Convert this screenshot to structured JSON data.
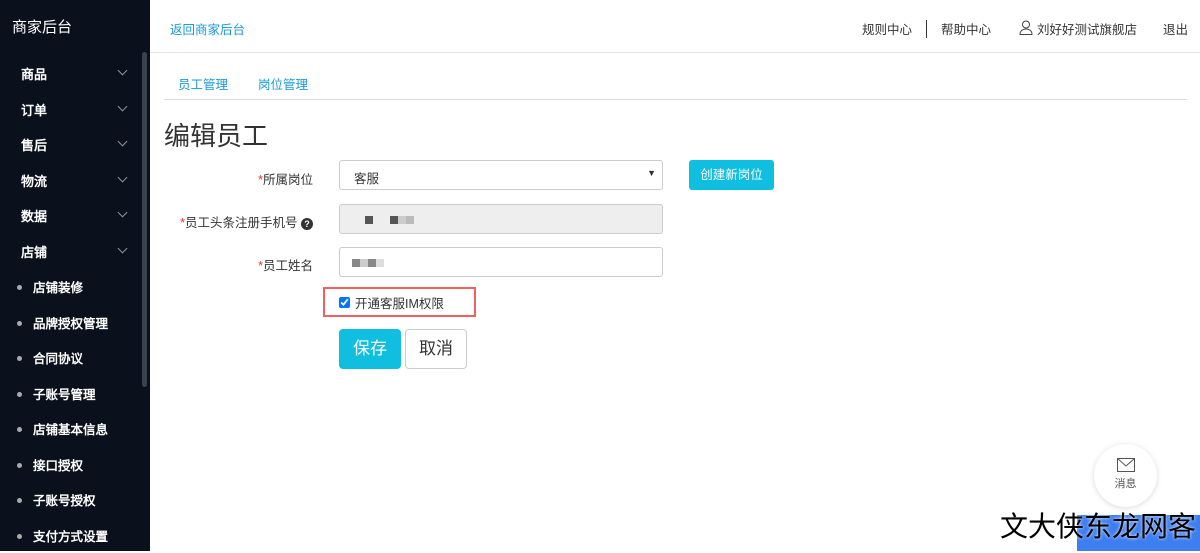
{
  "sidebar": {
    "brand": "商家后台",
    "menu": [
      "商品",
      "订单",
      "售后",
      "物流",
      "数据",
      "店铺"
    ],
    "sub": [
      "店铺装修",
      "品牌授权管理",
      "合同协议",
      "子账号管理",
      "店铺基本信息",
      "接口授权",
      "子账号授权",
      "支付方式设置"
    ]
  },
  "topbar": {
    "back": "返回商家后台",
    "rules": "规则中心",
    "help": "帮助中心",
    "user": "刘好好测试旗舰店",
    "logout": "退出"
  },
  "tabs": [
    "员工管理",
    "岗位管理"
  ],
  "form": {
    "title": "编辑员工",
    "position_label": "所属岗位",
    "position_value": "客服",
    "create_position": "创建新岗位",
    "phone_label": "员工头条注册手机号",
    "name_label": "员工姓名",
    "im_label": "开通客服IM权限",
    "im_checked": true,
    "save": "保存",
    "cancel": "取消",
    "required_mark": "*"
  },
  "float": {
    "message": "消息"
  },
  "watermark": "文大侠东龙网客"
}
